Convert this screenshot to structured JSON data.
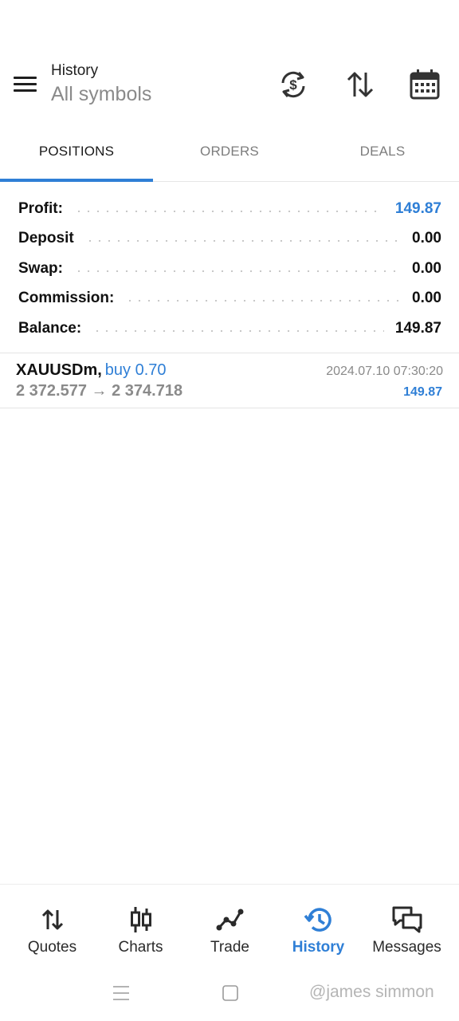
{
  "header": {
    "subtitle": "History",
    "title": "All symbols",
    "icons": [
      "menu-icon",
      "currency-exchange-icon",
      "sort-icon",
      "calendar-icon"
    ]
  },
  "tabs": [
    {
      "label": "POSITIONS",
      "active": true
    },
    {
      "label": "ORDERS",
      "active": false
    },
    {
      "label": "DEALS",
      "active": false
    }
  ],
  "summary": [
    {
      "label": "Profit:",
      "value": "149.87"
    },
    {
      "label": "Deposit",
      "value": "0.00"
    },
    {
      "label": "Swap:",
      "value": "0.00"
    },
    {
      "label": "Commission:",
      "value": "0.00"
    },
    {
      "label": "Balance:",
      "value": "149.87"
    }
  ],
  "positions": [
    {
      "symbol": "XAUUSDm,",
      "direction": "buy 0.70",
      "prices": "2 372.577 → 2 374.718",
      "time": "2024.07.10 07:30:20",
      "profit": "149.87"
    }
  ],
  "bottom_nav": [
    {
      "label": "Quotes",
      "icon": "quotes-icon"
    },
    {
      "label": "Charts",
      "icon": "candlestick-icon"
    },
    {
      "label": "Trade",
      "icon": "trade-line-icon"
    },
    {
      "label": "History",
      "icon": "history-icon",
      "active": true
    },
    {
      "label": "Messages",
      "icon": "messages-icon"
    }
  ],
  "watermark": "@james simmon",
  "colors": {
    "accent": "#2f7fd6",
    "text": "#111111",
    "muted": "#8a8a8a"
  }
}
